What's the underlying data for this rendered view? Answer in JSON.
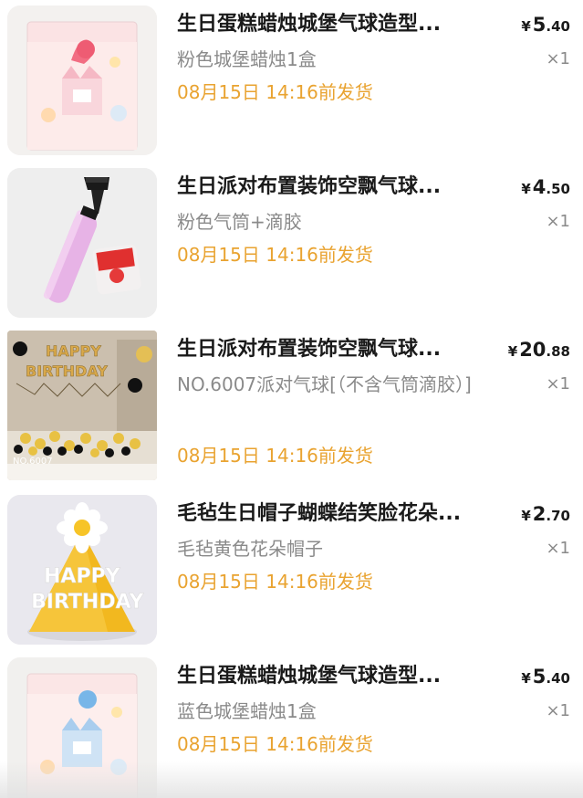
{
  "order_items": [
    {
      "title": "生日蛋糕蜡烛城堡气球造型...",
      "price_currency": "¥",
      "price_int": "5",
      "price_dec": ".40",
      "variant": "粉色城堡蜡烛1盒",
      "qty": "×1",
      "ship_time": "08月15日 14:16前发货",
      "image_icon": "pink-castle-candle-box-image"
    },
    {
      "title": "生日派对布置装饰空飘气球...",
      "price_currency": "¥",
      "price_int": "4",
      "price_dec": ".50",
      "variant": "粉色气筒+滴胶",
      "qty": "×1",
      "ship_time": "08月15日 14:16前发货",
      "image_icon": "pink-balloon-pump-image"
    },
    {
      "title": "生日派对布置装饰空飘气球...",
      "price_currency": "¥",
      "price_int": "20",
      "price_dec": ".88",
      "variant": "NO.6007派对气球[（不含气筒滴胶）]",
      "qty": "×1",
      "ship_time": "08月15日 14:16前发货",
      "image_icon": "happy-birthday-balloon-set-image",
      "image_text": {
        "banner_line1": "HAPPY",
        "banner_line2": "BIRTHDAY",
        "model_no": "NO.6007"
      }
    },
    {
      "title": "毛毡生日帽子蝴蝶结笑脸花朵...",
      "price_currency": "¥",
      "price_int": "2",
      "price_dec": ".70",
      "variant": "毛毡黄色花朵帽子",
      "qty": "×1",
      "ship_time": "08月15日 14:16前发货",
      "image_icon": "yellow-felt-birthday-hat-image",
      "image_text": {
        "line1": "HAPPY",
        "line2": "BIRTHDAY"
      }
    },
    {
      "title": "生日蛋糕蜡烛城堡气球造型...",
      "price_currency": "¥",
      "price_int": "5",
      "price_dec": ".40",
      "variant": "蓝色城堡蜡烛1盒",
      "qty": "×1",
      "ship_time": "08月15日 14:16前发货",
      "image_icon": "blue-castle-candle-box-image"
    }
  ],
  "colors": {
    "ship_time": "#e9a330",
    "secondary_text": "#8a8a8a",
    "title_text": "#1a1a1a"
  }
}
